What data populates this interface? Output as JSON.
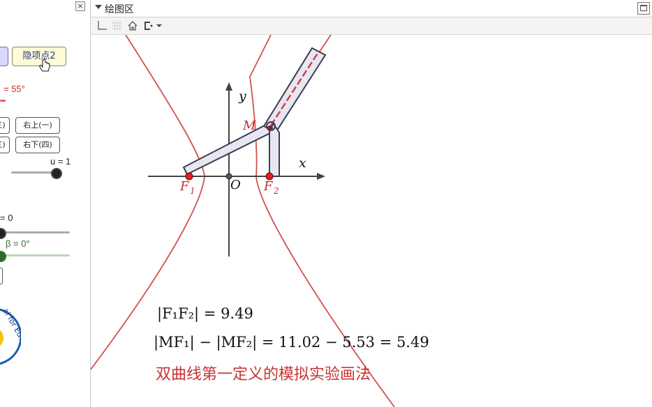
{
  "left_panel": {
    "close_glyph": "×",
    "hide_vertex_button": "隐项点2",
    "alpha_label": "= 55°",
    "quadrant_buttons": {
      "q1": "右上(一)",
      "q4": "右下(四)",
      "q2": "三)",
      "q3": "三)"
    },
    "u_label": "u = 1",
    "zero_label": "= 0",
    "beta_label": "β = 0°",
    "logo_text": "ai for Educatio"
  },
  "graphics": {
    "title": "绘图区",
    "toolbar_icons": [
      "axes-icon",
      "grid-icon",
      "home-icon",
      "point-capture-icon"
    ],
    "axis_x": "x",
    "axis_y": "y",
    "point_m": "M",
    "point_f1": "F",
    "point_f1_sub": "1",
    "point_f2": "F",
    "point_f2_sub": "2",
    "origin": "O",
    "eq_line1": "|F₁F₂| = 9.49",
    "eq_line2": "|MF₁| − |MF₂| = 11.02 − 5.53 = 5.49",
    "caption": "双曲线第一定义的模拟实验画法",
    "colors": {
      "curve": "#c83232",
      "point": "#e02020",
      "rod_fill": "#e8e6f2",
      "rod_stroke": "#3c3c50"
    }
  },
  "math_values": {
    "F1F2": 9.49,
    "MF1": 11.02,
    "MF2": 5.53,
    "difference": 5.49
  }
}
